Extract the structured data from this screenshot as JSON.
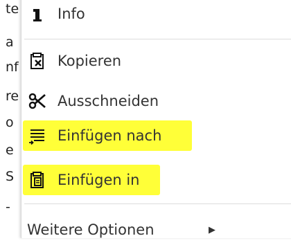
{
  "background_fragments": [
    "te",
    "a",
    "nf",
    "re",
    "o",
    "e",
    "S",
    "-"
  ],
  "menu": {
    "items": [
      {
        "label": "Info",
        "icon": "info-icon"
      },
      {
        "label": "Kopieren",
        "icon": "copy-icon"
      },
      {
        "label": "Ausschneiden",
        "icon": "scissors-icon"
      },
      {
        "label": "Einfügen nach",
        "icon": "paste-after-icon",
        "highlighted": true
      },
      {
        "label": "Einfügen in",
        "icon": "paste-into-icon",
        "highlighted": true
      },
      {
        "label": "Weitere Optionen",
        "icon": "chevron-right-icon"
      }
    ],
    "highlight_color": "#ffff00"
  }
}
